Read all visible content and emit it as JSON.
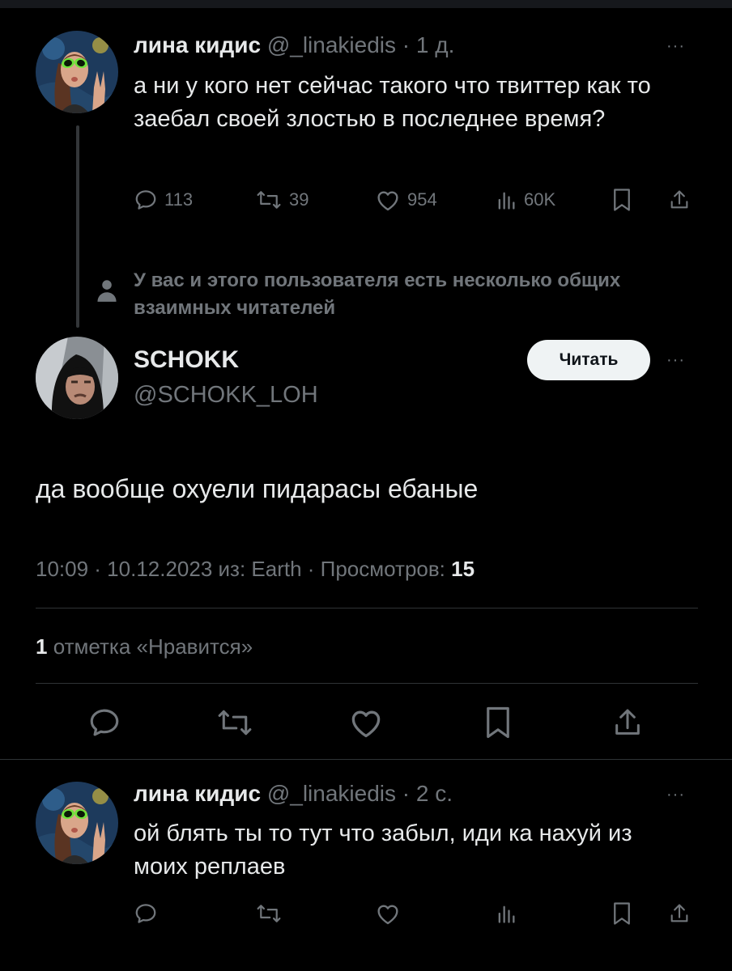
{
  "tweet1": {
    "name": "лина кидис",
    "handle": "@_linakiedis",
    "time": "· 1 д.",
    "more": "···",
    "text": "а ни у кого нет сейчас такого что твиттер как то заебал своей злостью в последнее время?",
    "replies": "113",
    "retweets": "39",
    "likes": "954",
    "views": "60K"
  },
  "mutuals_note": "У вас и этого пользователя есть несколько общих взаимных читателей",
  "main": {
    "name": "SCHOKK",
    "handle": "@SCHOKK_LOH",
    "follow_label": "Читать",
    "more": "···",
    "text": "да вообще охуели пидарасы ебаные",
    "meta": "10:09 · 10.12.2023 из: Earth · Просмотров:",
    "views_count": "15",
    "likes_count": "1",
    "likes_label": "отметка «Нравится»"
  },
  "tweet2": {
    "name": "лина кидис",
    "handle": "@_linakiedis",
    "time": "· 2 с.",
    "more": "···",
    "text": "ой блять ты то тут что забыл, иди ка нахуй из моих реплаев"
  },
  "colors": {
    "background": "#000000",
    "text": "#e7e9ea",
    "muted": "#71767b",
    "divider": "#2f3336",
    "alien_green": "#6fe33a"
  }
}
